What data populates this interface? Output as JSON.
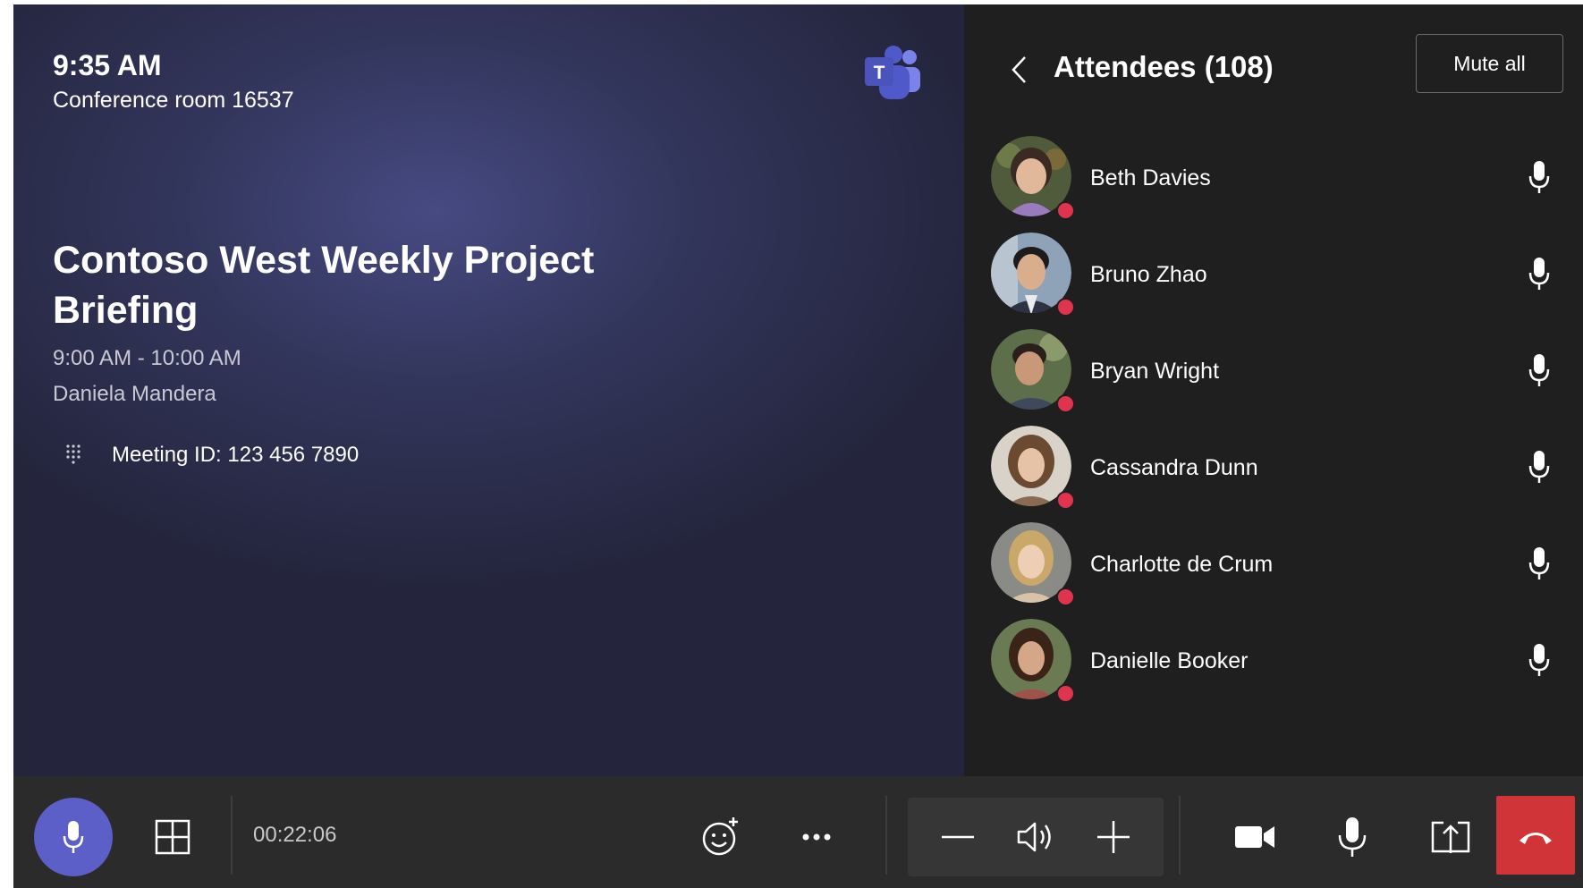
{
  "meeting": {
    "clock": "9:35 AM",
    "room": "Conference room 16537",
    "title": "Contoso West Weekly Project Briefing",
    "time_range": "9:00 AM - 10:00 AM",
    "organizer": "Daniela Mandera",
    "meeting_id": "Meeting ID: 123 456 7890",
    "logo_icon": "teams-logo",
    "dialpad_icon": "dialpad-icon"
  },
  "attendees_panel": {
    "title": "Attendees (108)",
    "mute_all_label": "Mute all",
    "back_icon": "chevron-left-icon",
    "attendees": [
      {
        "name": "Beth Davies",
        "status": "busy",
        "mic_icon": "microphone-icon"
      },
      {
        "name": "Bruno Zhao",
        "status": "busy",
        "mic_icon": "microphone-icon"
      },
      {
        "name": "Bryan Wright",
        "status": "busy",
        "mic_icon": "microphone-icon"
      },
      {
        "name": "Cassandra Dunn",
        "status": "busy",
        "mic_icon": "microphone-icon"
      },
      {
        "name": "Charlotte de Crum",
        "status": "busy",
        "mic_icon": "microphone-icon"
      },
      {
        "name": "Danielle Booker",
        "status": "busy",
        "mic_icon": "microphone-icon"
      }
    ]
  },
  "toolbar": {
    "timer": "00:22:06",
    "icons": [
      "microphone-icon",
      "layout-grid-icon",
      "emoji-icon",
      "more-options-icon",
      "volume-down-icon",
      "speaker-icon",
      "volume-up-icon",
      "video-camera-icon",
      "microphone-icon",
      "share-screen-icon",
      "hang-up-icon"
    ]
  },
  "colors": {
    "accent": "#5b5fc7",
    "hangup": "#d13438",
    "status_busy": "#e0334d",
    "panel_bg": "#1f1f1f",
    "toolbar_bg": "#2b2b2b"
  }
}
